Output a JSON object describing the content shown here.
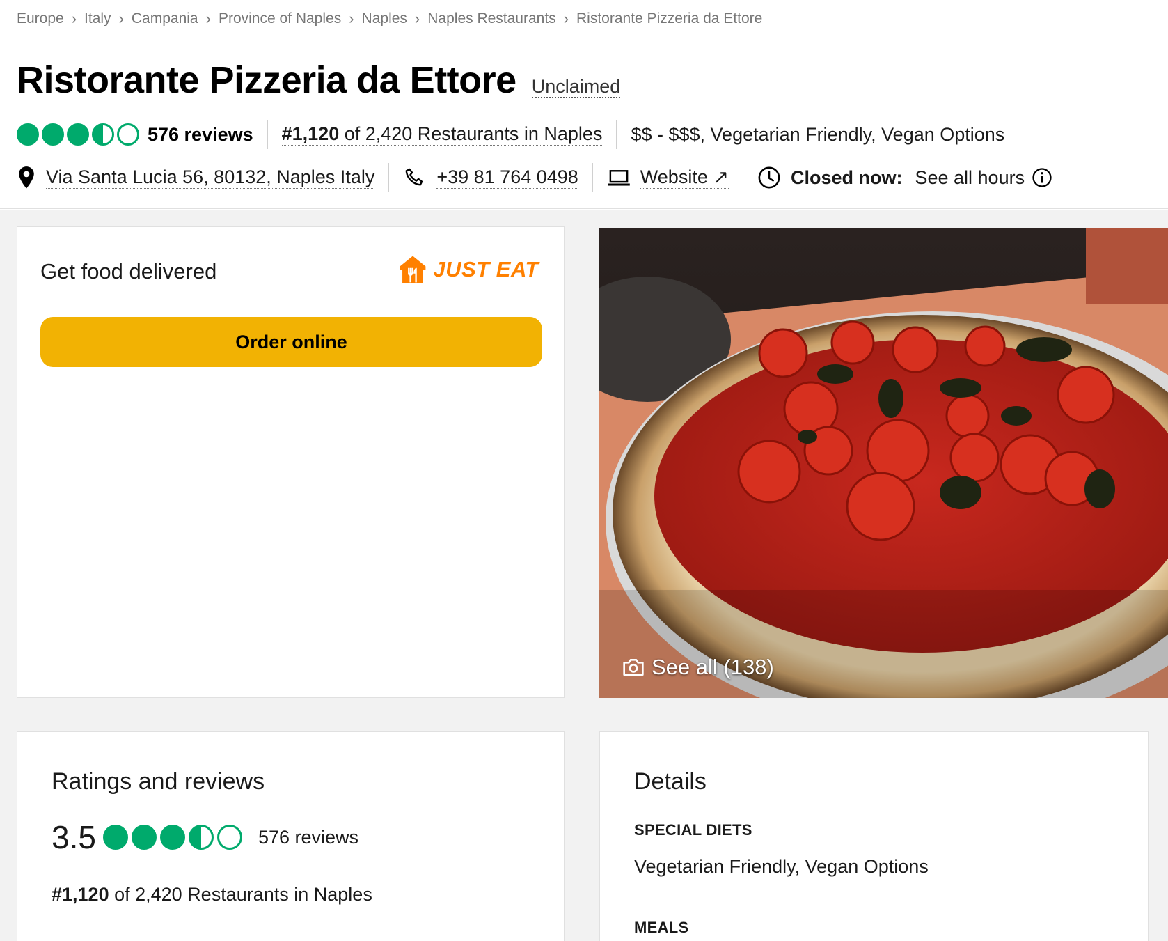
{
  "breadcrumb": [
    "Europe",
    "Italy",
    "Campania",
    "Province of Naples",
    "Naples",
    "Naples Restaurants",
    "Ristorante Pizzeria da Ettore"
  ],
  "header": {
    "title": "Ristorante Pizzeria da Ettore",
    "unclaimed": "Unclaimed",
    "rating": 3.5,
    "reviews": "576 reviews",
    "rank_prefix": "#1,120",
    "rank_suffix": " of 2,420 Restaurants in Naples",
    "price_cuisine": "$$ - $$$, Vegetarian Friendly, Vegan Options",
    "address": "Via Santa Lucia 56, 80132, Naples Italy",
    "phone": "+39 81 764 0498",
    "website": "Website",
    "closed_label": "Closed now:",
    "hours_link": "See all hours"
  },
  "delivery": {
    "title": "Get food delivered",
    "partner": "JUST EAT",
    "order_button": "Order online"
  },
  "photo": {
    "see_all": "See all (138)"
  },
  "ratings_card": {
    "title": "Ratings and reviews",
    "score": "3.5",
    "reviews": "576 reviews",
    "rank_prefix": "#1,120",
    "rank_suffix": " of 2,420 Restaurants in Naples"
  },
  "details_card": {
    "title": "Details",
    "special_diets_heading": "SPECIAL DIETS",
    "special_diets_value": "Vegetarian Friendly, Vegan Options",
    "meals_heading": "MEALS"
  },
  "colors": {
    "rating_green": "#00aa6c",
    "order_yellow": "#f2b203",
    "justeat_orange": "#ff8000"
  }
}
